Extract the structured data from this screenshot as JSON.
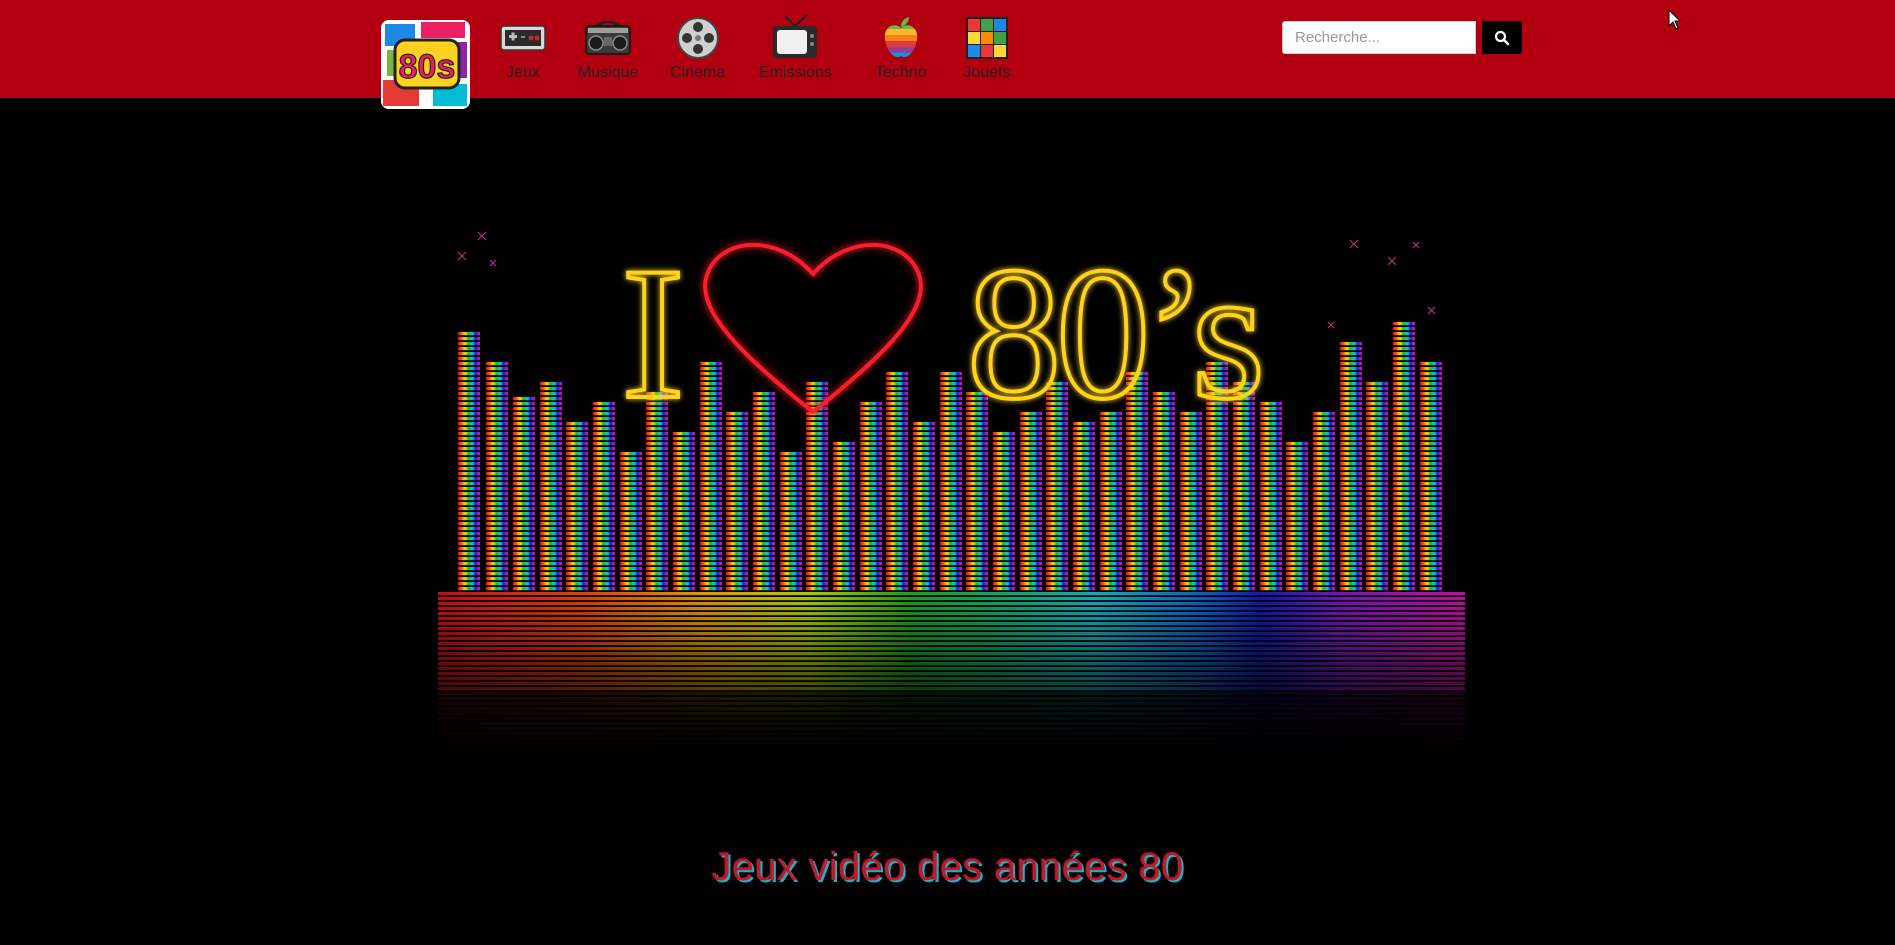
{
  "header": {
    "logo_alt": "80s",
    "nav": [
      {
        "label": "Jeux",
        "icon": "gamepad-icon"
      },
      {
        "label": "Musique",
        "icon": "boombox-icon"
      },
      {
        "label": "Cinema",
        "icon": "film-reel-icon"
      },
      {
        "label": "Emissions",
        "icon": "tv-icon"
      },
      {
        "label": "Techno",
        "icon": "apple-logo-icon"
      },
      {
        "label": "Jouets",
        "icon": "rubiks-cube-icon"
      }
    ],
    "search": {
      "placeholder": "Recherche...",
      "value": ""
    }
  },
  "hero": {
    "text_before": "I",
    "text_after": "80’s",
    "heart_icon": "heart-icon"
  },
  "main": {
    "title": "Jeux vidéo des années 80"
  },
  "colors": {
    "header_bg": "#b30010",
    "page_bg": "#000000",
    "neon_yellow": "#ffd21f",
    "neon_red": "#ff1a2a"
  }
}
